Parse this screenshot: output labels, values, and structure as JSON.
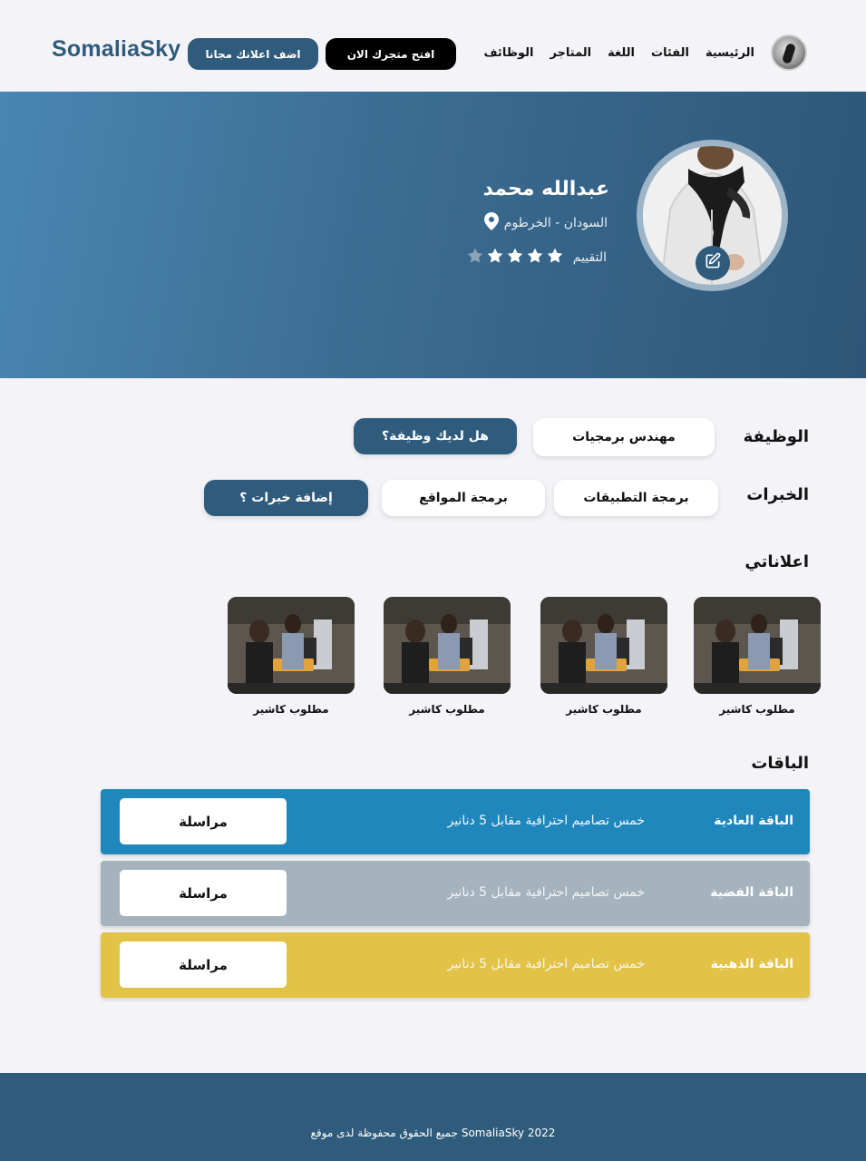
{
  "header": {
    "logo": "SomaliaSky",
    "add_ad_label": "اضف اعلانك مجانا",
    "open_store_label": "افتح متجرك الان",
    "nav": [
      "الرئيسية",
      "الفئات",
      "اللغة",
      "المتاجر",
      "الوظائف"
    ]
  },
  "profile": {
    "name": "عبدالله محمد",
    "location": "السودان - الخرطوم",
    "rating_label": "التقييم",
    "rating_value": 4,
    "rating_max": 5
  },
  "job": {
    "label": "الوظيفة",
    "value": "مهندس برمجيات",
    "action": "هل لديك وظيفة؟"
  },
  "skills": {
    "label": "الخبرات",
    "items": [
      "برمجة التطبيقات",
      "برمجة المواقع"
    ],
    "action": "إضافة خبرات ؟"
  },
  "ads": {
    "title": "اعلاناتي",
    "items": [
      {
        "title": "مطلوب كاشير"
      },
      {
        "title": "مطلوب كاشير"
      },
      {
        "title": "مطلوب كاشير"
      },
      {
        "title": "مطلوب كاشير"
      }
    ]
  },
  "packages": {
    "title": "الباقات",
    "items": [
      {
        "name": "الباقة العادية",
        "desc": "خمس تصاميم احترافية مقابل 5 دنانير",
        "button": "مراسلة",
        "color": "#1f87bc"
      },
      {
        "name": "الباقة الفضية",
        "desc": "خمس تصاميم احترافية مقابل 5 دنانير",
        "button": "مراسلة",
        "color": "#a4b3bd"
      },
      {
        "name": "الباقة الذهبية",
        "desc": "خمس تصاميم احترافية مقابل 5 دنانير",
        "button": "مراسلة",
        "color": "#e2c247"
      }
    ]
  },
  "footer": {
    "text": "SomaliaSky 2022 جميع الحقوق محفوظة لدى موقع"
  },
  "colors": {
    "brand": "#2f5b7c",
    "hero_start": "#4a86b1",
    "hero_end": "#2d5677"
  }
}
